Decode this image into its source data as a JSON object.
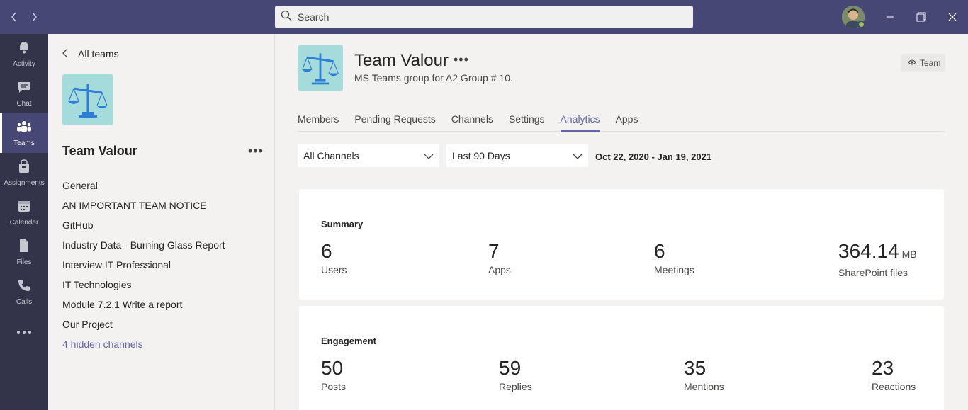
{
  "titlebar": {
    "search_placeholder": "Search"
  },
  "rail": [
    {
      "label": "Activity",
      "icon": "bell-icon"
    },
    {
      "label": "Chat",
      "icon": "chat-icon"
    },
    {
      "label": "Teams",
      "icon": "teams-icon"
    },
    {
      "label": "Assignments",
      "icon": "assignments-icon"
    },
    {
      "label": "Calendar",
      "icon": "calendar-icon"
    },
    {
      "label": "Files",
      "icon": "file-icon"
    },
    {
      "label": "Calls",
      "icon": "phone-icon"
    }
  ],
  "leftpanel": {
    "back_label": "All teams",
    "team_name": "Team Valour",
    "channels": [
      "General",
      "AN IMPORTANT TEAM NOTICE",
      "GitHub",
      "Industry Data - Burning Glass Report",
      "Interview IT Professional",
      "IT Technologies",
      "Module 7.2.1 Write a report",
      "Our Project"
    ],
    "hidden_channels": "4 hidden channels"
  },
  "main": {
    "title": "Team Valour",
    "description": "MS Teams group for A2 Group # 10.",
    "badge": "Team",
    "tabs": [
      "Members",
      "Pending Requests",
      "Channels",
      "Settings",
      "Analytics",
      "Apps"
    ],
    "active_tab": "Analytics",
    "filters": {
      "channel": "All Channels",
      "period": "Last 90 Days",
      "date_range": "Oct 22, 2020 - Jan 19, 2021"
    },
    "summary": {
      "title": "Summary",
      "users": {
        "value": "6",
        "label": "Users"
      },
      "apps": {
        "value": "7",
        "label": "Apps"
      },
      "meetings": {
        "value": "6",
        "label": "Meetings"
      },
      "sharepoint": {
        "value": "364.14",
        "unit": "MB",
        "label": "SharePoint files"
      }
    },
    "engagement": {
      "title": "Engagement",
      "posts": {
        "value": "50",
        "label": "Posts"
      },
      "replies": {
        "value": "59",
        "label": "Replies"
      },
      "mentions": {
        "value": "35",
        "label": "Mentions"
      },
      "reactions": {
        "value": "23",
        "label": "Reactions"
      }
    }
  },
  "colors": {
    "titlebar": "#464775",
    "rail": "#33344a",
    "accent": "#6264a7",
    "team_icon_bg": "#a6dbdb"
  }
}
